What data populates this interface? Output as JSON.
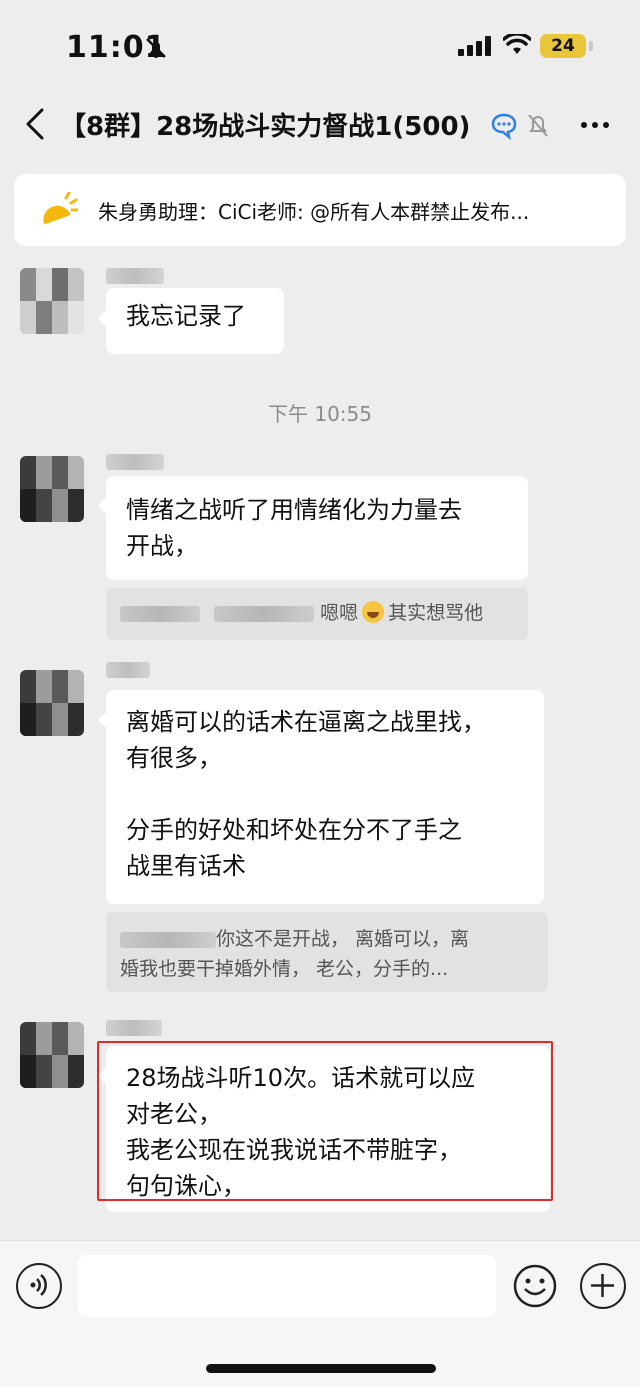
{
  "status_bar": {
    "time": "11:01",
    "battery": "24"
  },
  "nav": {
    "title": "【8群】28场战斗实力督战1",
    "member_count": "(500)"
  },
  "announcement": {
    "text": "朱身勇助理：CiCi老师: @所有人本群禁止发布..."
  },
  "messages": [
    {
      "lines": [
        "我忘记录了"
      ]
    },
    {
      "lines": [
        "情绪之战听了用情绪化为力量去",
        "开战，"
      ],
      "quote": {
        "text_after": "嗯嗯",
        "text_end": "其实想骂他"
      }
    },
    {
      "lines": [
        "离婚可以的话术在逼离之战里找，",
        "有很多，",
        "",
        "分手的好处和坏处在分不了手之",
        "战里有话术"
      ],
      "quote": {
        "line1": "你这不是开战，  离婚可以，离",
        "line2": "婚我也要干掉婚外情，  老公，分手的..."
      }
    },
    {
      "lines": [
        "28场战斗听10次。话术就可以应",
        "对老公，",
        "我老公现在说我说话不带脏字，",
        "句句诛心，"
      ]
    }
  ],
  "timestamp": "下午 10:55",
  "colors": {
    "background": "#ededed",
    "bubble": "#ffffff",
    "highlight_border": "#e02b2b",
    "battery": "#e9c53a"
  },
  "icons": [
    "bell-slash-icon",
    "signal-icon",
    "wifi-icon",
    "back-icon",
    "group-chat-icon",
    "mute-icon",
    "more-icon",
    "announcement-icon",
    "voice-icon",
    "emoji-icon",
    "plus-icon"
  ]
}
